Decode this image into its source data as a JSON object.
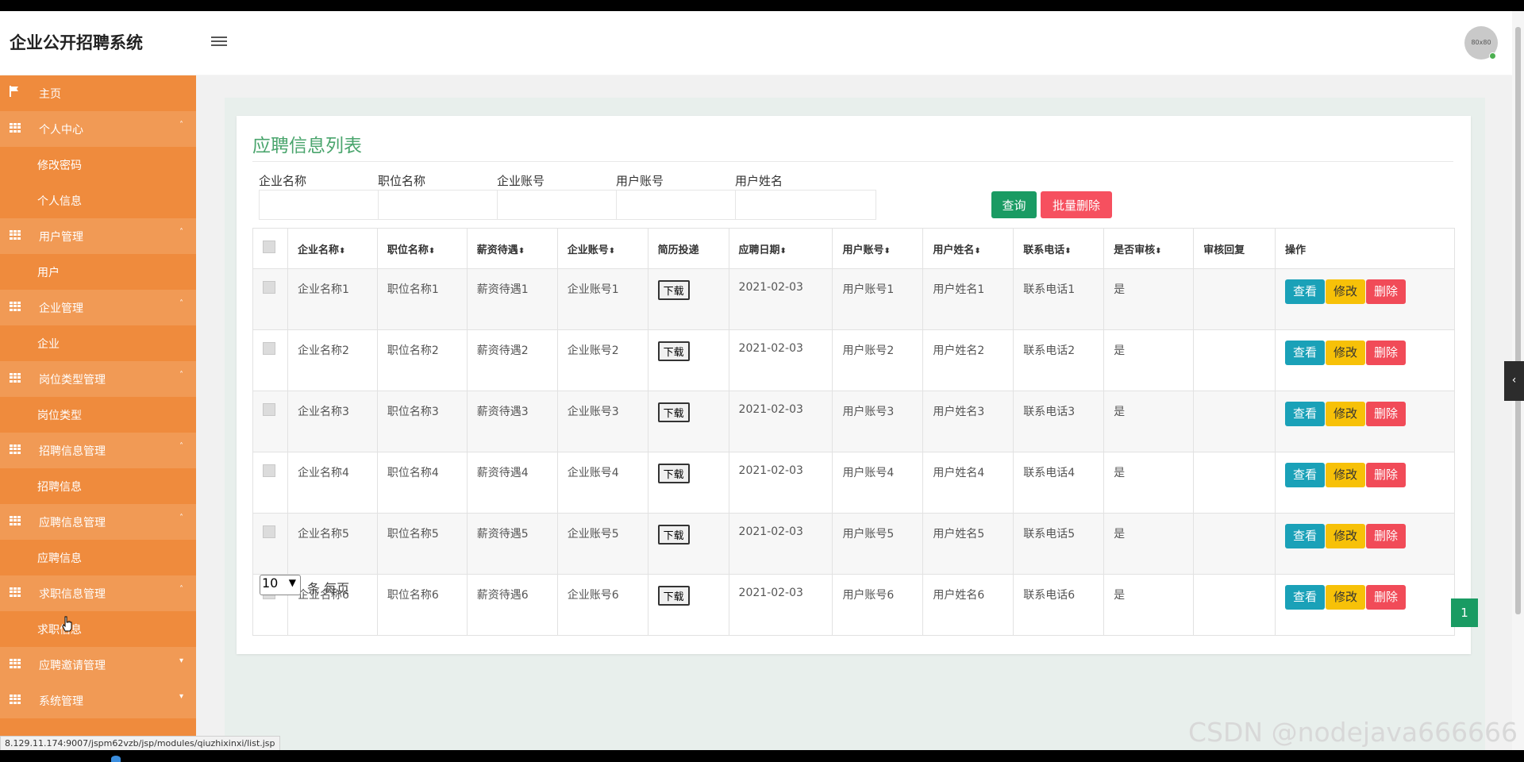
{
  "app": {
    "title": "企业公开招聘系统",
    "avatar_text": "80x80"
  },
  "sidebar": {
    "items": [
      {
        "type": "home",
        "label": "主页",
        "icon": "flag-icon"
      },
      {
        "type": "parent",
        "label": "个人中心",
        "icon": "grid-icon",
        "caret": "up"
      },
      {
        "type": "child",
        "label": "修改密码"
      },
      {
        "type": "child",
        "label": "个人信息"
      },
      {
        "type": "parent",
        "label": "用户管理",
        "icon": "grid-icon",
        "caret": "up"
      },
      {
        "type": "child",
        "label": "用户"
      },
      {
        "type": "parent",
        "label": "企业管理",
        "icon": "grid-icon",
        "caret": "up"
      },
      {
        "type": "child",
        "label": "企业"
      },
      {
        "type": "parent",
        "label": "岗位类型管理",
        "icon": "grid-icon",
        "caret": "up"
      },
      {
        "type": "child",
        "label": "岗位类型"
      },
      {
        "type": "parent",
        "label": "招聘信息管理",
        "icon": "grid-icon",
        "caret": "up"
      },
      {
        "type": "child",
        "label": "招聘信息"
      },
      {
        "type": "parent",
        "label": "应聘信息管理",
        "icon": "grid-icon",
        "caret": "up"
      },
      {
        "type": "child",
        "label": "应聘信息"
      },
      {
        "type": "parent",
        "label": "求职信息管理",
        "icon": "grid-icon",
        "caret": "up"
      },
      {
        "type": "child",
        "label": "求职信息"
      },
      {
        "type": "parent",
        "label": "应聘邀请管理",
        "icon": "grid-icon",
        "caret": "down"
      },
      {
        "type": "parent",
        "label": "系统管理",
        "icon": "grid-icon",
        "caret": "down"
      }
    ]
  },
  "main": {
    "title": "应聘信息列表",
    "filters": [
      {
        "label": "企业名称",
        "value": ""
      },
      {
        "label": "职位名称",
        "value": ""
      },
      {
        "label": "企业账号",
        "value": ""
      },
      {
        "label": "用户账号",
        "value": ""
      },
      {
        "label": "用户姓名",
        "value": ""
      }
    ],
    "query_button": "查询",
    "batch_delete_button": "批量删除",
    "table": {
      "columns": [
        {
          "label": "企业名称",
          "sortable": true
        },
        {
          "label": "职位名称",
          "sortable": true
        },
        {
          "label": "薪资待遇",
          "sortable": true
        },
        {
          "label": "企业账号",
          "sortable": true
        },
        {
          "label": "简历投递",
          "sortable": false
        },
        {
          "label": "应聘日期",
          "sortable": true
        },
        {
          "label": "用户账号",
          "sortable": true
        },
        {
          "label": "用户姓名",
          "sortable": true
        },
        {
          "label": "联系电话",
          "sortable": true
        },
        {
          "label": "是否审核",
          "sortable": true
        },
        {
          "label": "审核回复",
          "sortable": false
        },
        {
          "label": "操作",
          "sortable": false
        }
      ],
      "sort_icon": "⬍",
      "download_label": "下载",
      "actions": {
        "view": "查看",
        "edit": "修改",
        "delete": "删除"
      },
      "rows": [
        [
          "企业名称1",
          "职位名称1",
          "薪资待遇1",
          "企业账号1",
          "2021-02-03",
          "用户账号1",
          "用户姓名1",
          "联系电话1",
          "是",
          ""
        ],
        [
          "企业名称2",
          "职位名称2",
          "薪资待遇2",
          "企业账号2",
          "2021-02-03",
          "用户账号2",
          "用户姓名2",
          "联系电话2",
          "是",
          ""
        ],
        [
          "企业名称3",
          "职位名称3",
          "薪资待遇3",
          "企业账号3",
          "2021-02-03",
          "用户账号3",
          "用户姓名3",
          "联系电话3",
          "是",
          ""
        ],
        [
          "企业名称4",
          "职位名称4",
          "薪资待遇4",
          "企业账号4",
          "2021-02-03",
          "用户账号4",
          "用户姓名4",
          "联系电话4",
          "是",
          ""
        ],
        [
          "企业名称5",
          "职位名称5",
          "薪资待遇5",
          "企业账号5",
          "2021-02-03",
          "用户账号5",
          "用户姓名5",
          "联系电话5",
          "是",
          ""
        ],
        [
          "企业名称6",
          "职位名称6",
          "薪资待遇6",
          "企业账号6",
          "2021-02-03",
          "用户账号6",
          "用户姓名6",
          "联系电话6",
          "是",
          ""
        ]
      ]
    },
    "pagination": {
      "page_size": "10",
      "per_page_text": "条 每页",
      "current_page": "1"
    }
  },
  "status_bar": {
    "url": "8.129.11.174:9007/jspm62vzb/jsp/modules/qiuzhixinxi/list.jsp"
  },
  "watermark": "CSDN @nodejava666666",
  "colors": {
    "sidebar": "#ef8b3d",
    "accent_green": "#1a9b63",
    "danger": "#f14b58",
    "warning": "#f7c108",
    "info": "#1aa1b8",
    "title_green": "#4aa56d"
  }
}
